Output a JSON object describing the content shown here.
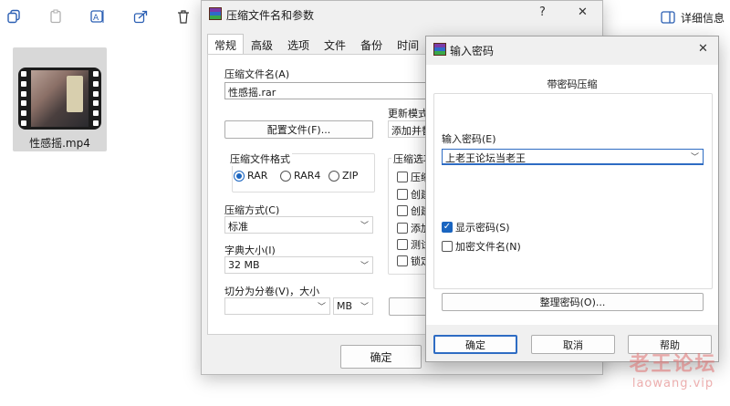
{
  "explorer": {
    "toolbar_icons": [
      "copy-icon",
      "paste-icon",
      "rename-icon",
      "share-icon",
      "delete-icon"
    ],
    "details_label": "详细信息",
    "file": {
      "name": "性感摇.mp4"
    }
  },
  "rar_dialog": {
    "title": "压缩文件名和参数",
    "help": "?",
    "close": "✕",
    "tabs": [
      "常规",
      "高级",
      "选项",
      "文件",
      "备份",
      "时间"
    ],
    "archive_name_label": "压缩文件名(A)",
    "archive_name_value": "性感摇.rar",
    "profiles_button": "配置文件(F)...",
    "update_mode_label": "更新模式",
    "update_mode_value": "添加并替",
    "format_label": "压缩文件格式",
    "format_options": [
      "RAR",
      "RAR4",
      "ZIP"
    ],
    "format_selected": "RAR",
    "method_label": "压缩方式(C)",
    "method_value": "标准",
    "dict_label": "字典大小(I)",
    "dict_value": "32 MB",
    "split_label": "切分为分卷(V)，大小",
    "split_unit": "MB",
    "options_label": "压缩选项",
    "options_items": [
      "压缩",
      "创建",
      "创建",
      "添加",
      "测试",
      "锁定"
    ],
    "ok_button": "确定"
  },
  "password_dialog": {
    "title": "输入密码",
    "close": "✕",
    "subtitle": "带密码压缩",
    "input_label": "输入密码(E)",
    "input_value": "上老王论坛当老王",
    "show_password": {
      "label": "显示密码(S)",
      "checked": true
    },
    "encrypt_names": {
      "label": "加密文件名(N)",
      "checked": false
    },
    "organize_button": "整理密码(O)...",
    "ok_button": "确定",
    "cancel_button": "取消",
    "help_button": "帮助"
  },
  "watermark": {
    "line1": "老王论坛",
    "line2": "laowang.vip"
  }
}
